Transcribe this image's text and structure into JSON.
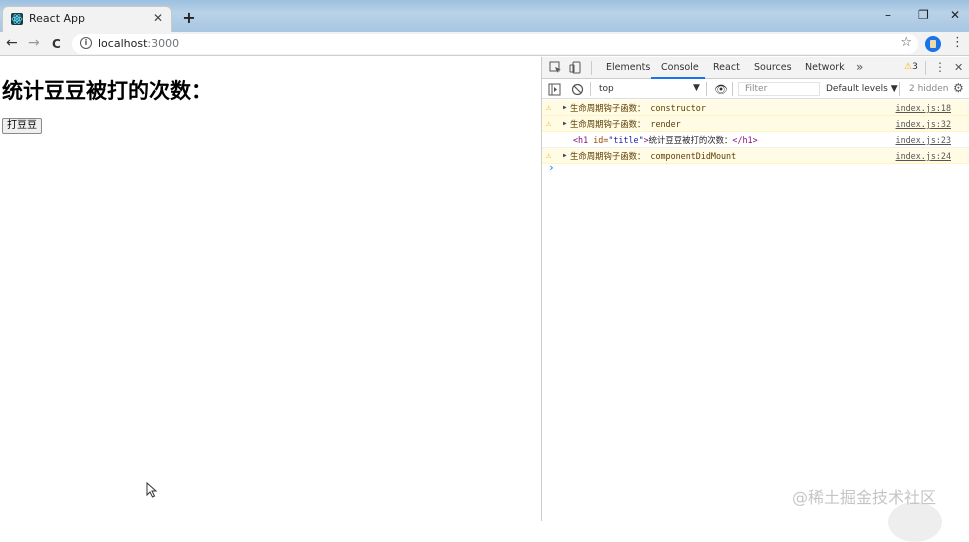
{
  "browser": {
    "tab_title": "React App",
    "tab_close": "✕",
    "new_tab": "+",
    "url_host": "localhost",
    "url_port": ":3000",
    "minimize": "–",
    "restore": "❐",
    "close": "✕",
    "back": "←",
    "forward": "→",
    "reload": "C",
    "info": "i",
    "bookmark": "☆",
    "menu": "⋮"
  },
  "page": {
    "title": "统计豆豆被打的次数：",
    "button_label": "打豆豆"
  },
  "devtools": {
    "tabs": [
      "Elements",
      "Console",
      "React",
      "Sources",
      "Network"
    ],
    "active_tab": "Console",
    "more_tabs": "»",
    "warning_count": "3",
    "menu": "⋮",
    "close": "✕",
    "context": "top",
    "context_arrow": "▼",
    "filter_placeholder": "Filter",
    "levels": "Default levels ▼",
    "hidden": "2 hidden",
    "logs": [
      {
        "level": "warning",
        "label": "生命周期钩子函数：",
        "value": "constructor",
        "source": "index.js:18"
      },
      {
        "level": "warning",
        "label": "生命周期钩子函数：",
        "value": "render",
        "source": "index.js:32"
      },
      {
        "level": "log",
        "open_tag": "<h1",
        "attr_name": "id=",
        "attr_value": "\"title\"",
        "tag_close": ">",
        "text": "统计豆豆被打的次数：",
        "close_tag": "</h1>",
        "source": "index.js:23"
      },
      {
        "level": "warning",
        "label": "生命周期钩子函数：",
        "value": "componentDidMount",
        "source": "index.js:24"
      }
    ],
    "prompt": "›"
  },
  "watermark": "@稀土掘金技术社区",
  "colors": {
    "accent": "#1a73e8",
    "warning": "#f4b400",
    "warning_bg": "#fffbe5"
  }
}
